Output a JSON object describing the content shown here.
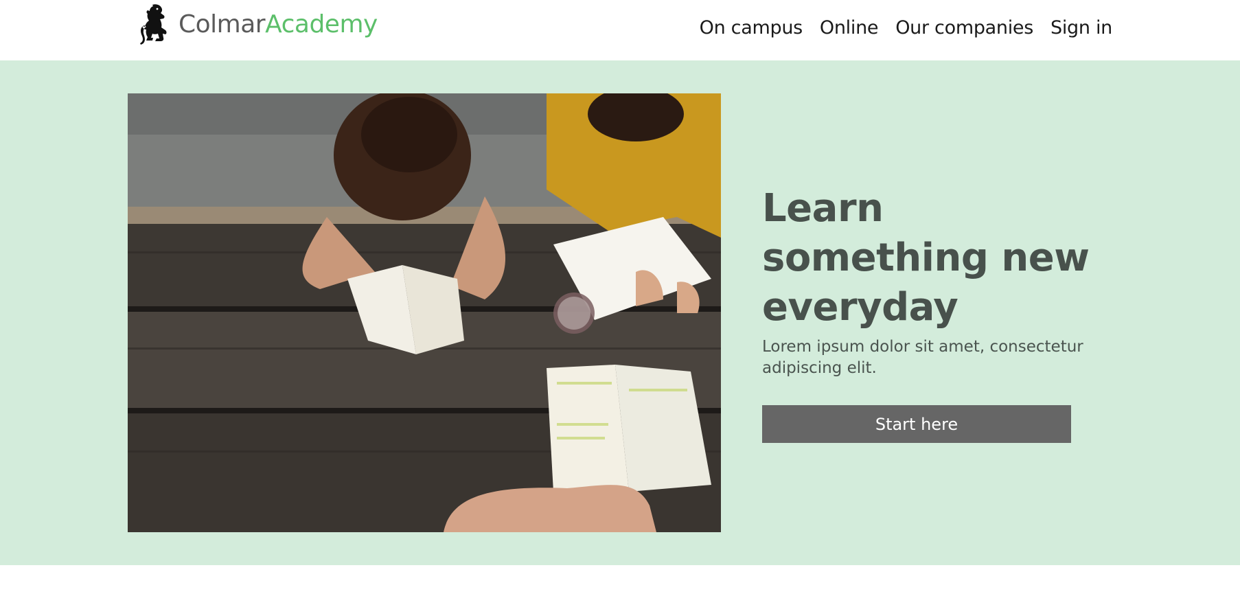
{
  "brand": {
    "name_part1": "Colmar",
    "name_part2": "Academy",
    "logo_icon": "lion-rampant-icon",
    "color_dark": "#5a5a5a",
    "color_accent": "#5cbf6a"
  },
  "nav": {
    "items": [
      {
        "label": "On campus"
      },
      {
        "label": "Online"
      },
      {
        "label": "Our companies"
      },
      {
        "label": "Sign in"
      }
    ]
  },
  "hero": {
    "background_color": "#d3ecdb",
    "image": "students-reading-at-picnic-table",
    "title": "Learn something new everyday",
    "text": "Lorem ipsum dolor sit amet, consectetur adipiscing elit.",
    "cta_label": "Start here",
    "cta_color": "#666666"
  }
}
